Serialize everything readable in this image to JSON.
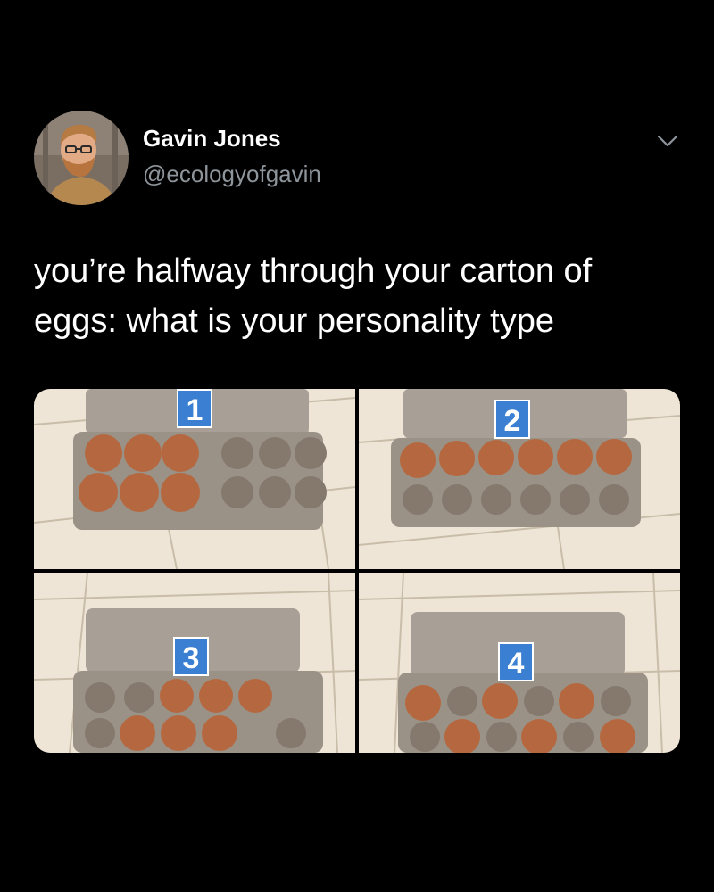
{
  "tweet": {
    "display_name": "Gavin Jones",
    "handle": "@ecologyofgavin",
    "text": "you’re halfway through your carton of\neggs: what is your personality type",
    "more_icon": "chevron-down-icon"
  },
  "photos": [
    {
      "number": "1",
      "eggs": 6,
      "arrangement": "six eggs packed at left end"
    },
    {
      "number": "2",
      "eggs": 6,
      "arrangement": "one full row of six"
    },
    {
      "number": "3",
      "eggs": 6,
      "arrangement": "six eggs packed in center"
    },
    {
      "number": "4",
      "eggs": 6,
      "arrangement": "alternating checkerboard"
    }
  ],
  "colors": {
    "background": "#000000",
    "text": "#ffffff",
    "secondary_text": "#8e959b",
    "label_blue": "#3a7fd1",
    "egg": "#b5683f",
    "carton": "#9a9187",
    "tile": "#eee5d6"
  }
}
